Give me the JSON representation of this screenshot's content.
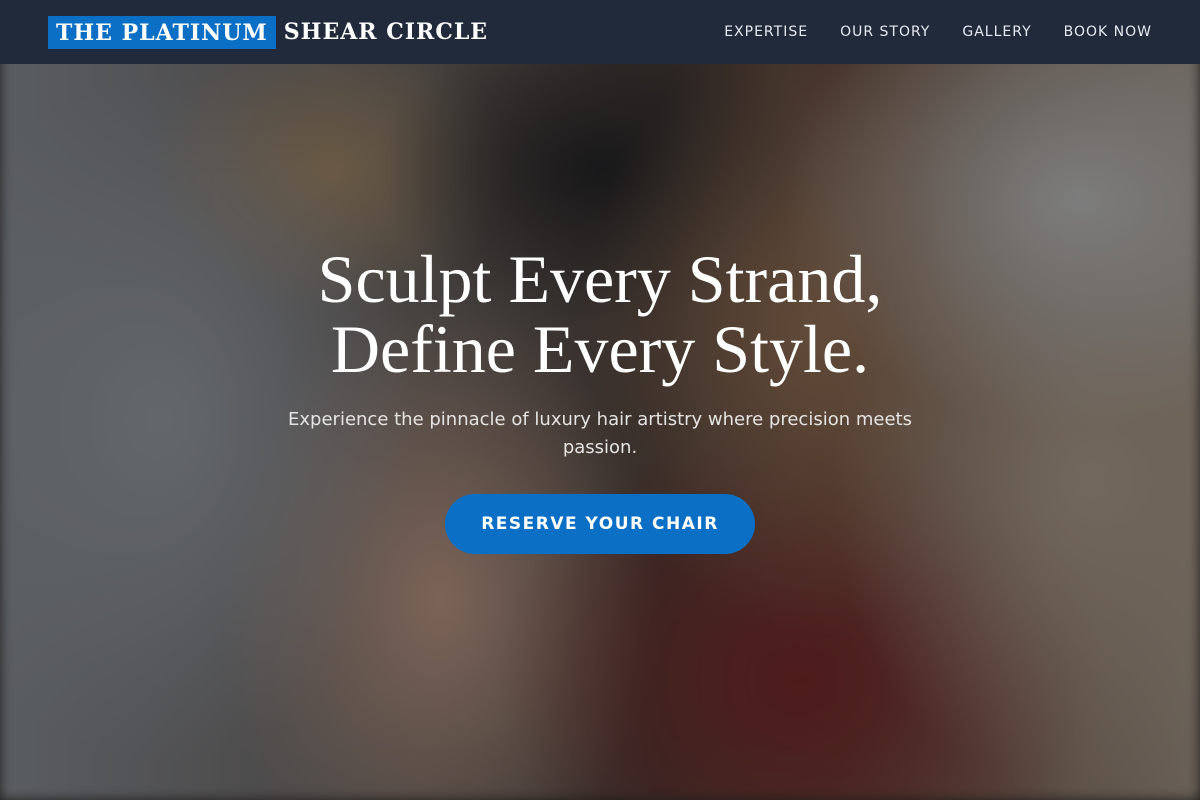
{
  "brand": {
    "highlight": "THE PLATINUM",
    "rest": "SHEAR CIRCLE"
  },
  "nav": {
    "items": [
      {
        "label": "EXPERTISE"
      },
      {
        "label": "OUR STORY"
      },
      {
        "label": "GALLERY"
      },
      {
        "label": "BOOK NOW"
      }
    ]
  },
  "hero": {
    "title_line_1": "Sculpt Every Strand,",
    "title_line_2": "Define Every Style.",
    "subtitle": "Experience the pinnacle of luxury hair artistry where precision meets passion.",
    "cta_label": "RESERVE YOUR CHAIR"
  },
  "colors": {
    "accent": "#0b6fc6",
    "navbar": "#202a3b",
    "text": "#ffffff"
  }
}
